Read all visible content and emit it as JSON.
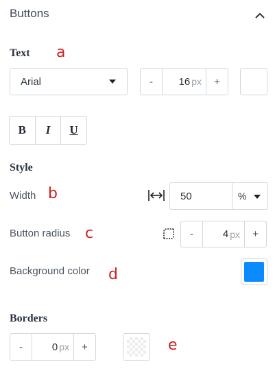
{
  "panel": {
    "title": "Buttons"
  },
  "text_section": {
    "title": "Text",
    "annotation": "a",
    "font_select": {
      "value": "Arial"
    },
    "font_size": {
      "minus": "-",
      "value": "16",
      "unit": "px",
      "plus": "+"
    },
    "bold_label": "B",
    "italic_label": "I",
    "underline_label": "U"
  },
  "style_section": {
    "title": "Style",
    "width": {
      "label": "Width",
      "annotation": "b",
      "value": "50",
      "unit": "%"
    },
    "radius": {
      "label": "Button radius",
      "annotation": "c",
      "minus": "-",
      "value": "4",
      "unit": "px",
      "plus": "+"
    },
    "background": {
      "label": "Background color",
      "annotation": "d",
      "color": "#0a8cff"
    }
  },
  "borders_section": {
    "title": "Borders",
    "width": {
      "minus": "-",
      "value": "0",
      "unit": "px",
      "plus": "+"
    },
    "annotation": "e"
  },
  "colors": {
    "text_color": "#ffffff",
    "annotation": "#d01e1e"
  }
}
